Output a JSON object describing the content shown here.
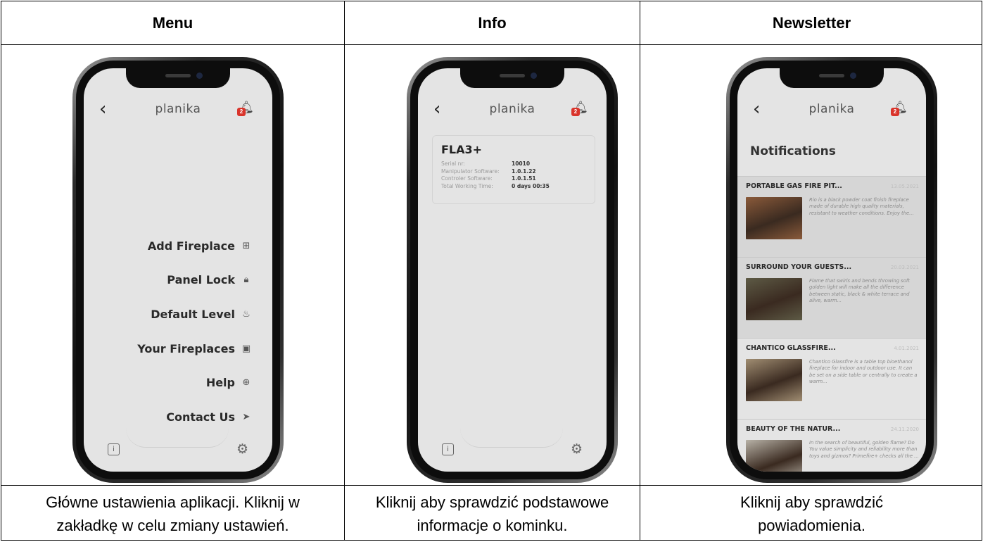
{
  "columns": [
    {
      "header": "Menu",
      "caption_lines": [
        "Główne ustawienia aplikacji. Kliknij w",
        "zakładkę w celu zmiany ustawień."
      ]
    },
    {
      "header": "Info",
      "caption_lines": [
        "Kliknij aby sprawdzić podstawowe",
        "informacje o kominku."
      ]
    },
    {
      "header": "Newsletter",
      "caption_lines": [
        "Kliknij aby sprawdzić",
        "powiadomienia."
      ]
    }
  ],
  "app": {
    "brand": "planika",
    "back_icon": "‹",
    "bell_icon": "bell-icon",
    "badge_count": "2",
    "info_icon": "i",
    "settings_icon": "⚙"
  },
  "menu": {
    "items": [
      {
        "label": "Add Fireplace",
        "icon": "⊞"
      },
      {
        "label": "Panel Lock",
        "icon": "🔒︎"
      },
      {
        "label": "Default Level",
        "icon": "♨"
      },
      {
        "label": "Your Fireplaces",
        "icon": "▣"
      },
      {
        "label": "Help",
        "icon": "⊕"
      },
      {
        "label": "Contact Us",
        "icon": "➤"
      }
    ]
  },
  "info": {
    "model": "FLA3+",
    "rows": [
      {
        "key": "Serial nr:",
        "value": "10010"
      },
      {
        "key": "Manipulator Software:",
        "value": "1.0.1.22"
      },
      {
        "key": "Controler Software:",
        "value": "1.0.1.51"
      },
      {
        "key": "Total Working Time:",
        "value": "0 days  00:35"
      }
    ]
  },
  "newsletter": {
    "heading": "Notifications",
    "items": [
      {
        "title": "PORTABLE GAS FIRE PIT...",
        "date": "13.05.2021",
        "text": "Rio is a black powder coat finish fireplace made of durable high quality materials, resistant to weather conditions. Enjoy the...",
        "thumb_color": "#8a5a3a"
      },
      {
        "title": "SURROUND YOUR GUESTS...",
        "date": "20.03.2021",
        "text": "Flame that swirls and bends throwing soft golden light will make all the difference between static, black & white terrace and alive, warm...",
        "thumb_color": "#5d5a45"
      },
      {
        "title": "CHANTICO GLASSFIRE...",
        "date": "4.01.2021",
        "text": "Chantico Glassfire is a table top bioethanol fireplace for indoor and outdoor use. It can be set on a side table or centrally to create a warm...",
        "thumb_color": "#a08d72"
      },
      {
        "title": "BEAUTY OF THE NATUR...",
        "date": "24.11.2020",
        "text": "In the search of beautiful, golden flame? Do You value simplicity and reliability more than toys and gizmos? Primefire+ checks all the ...",
        "thumb_color": "#b7b1a6"
      }
    ]
  }
}
